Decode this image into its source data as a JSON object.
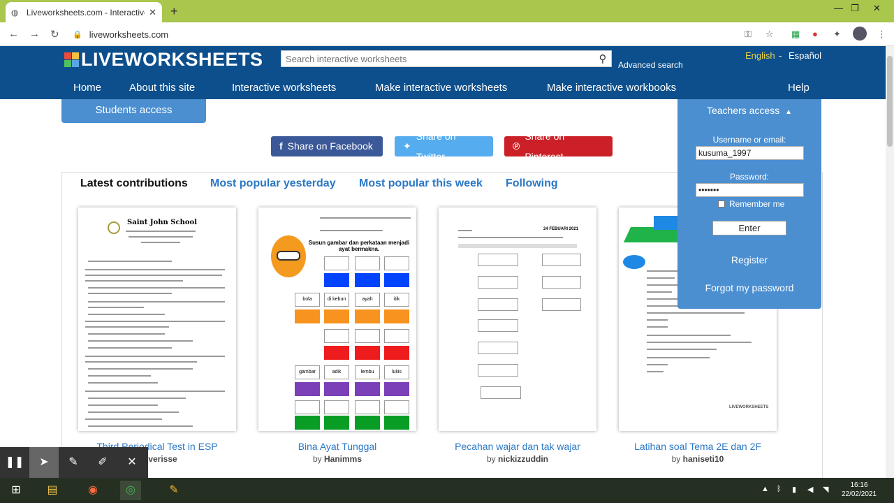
{
  "browser": {
    "tab_title": "Liveworksheets.com - Interactive",
    "url": "liveworksheets.com",
    "new_tab": "+",
    "close": "✕"
  },
  "header": {
    "logo": "LIVEWORKSHEETS",
    "search_placeholder": "Search interactive worksheets",
    "advanced_search": "Advanced search",
    "lang_en": "English",
    "lang_sep": "-",
    "lang_es": "Español",
    "menu": [
      "Home",
      "About this site",
      "Interactive worksheets",
      "Make interactive worksheets",
      "Make interactive workbooks",
      "Help"
    ]
  },
  "students_access": "Students access",
  "share": {
    "facebook": "Share on Facebook",
    "twitter": "Share on Twitter",
    "pinterest": "Share on Pinterest"
  },
  "tabs": [
    "Latest contributions",
    "Most popular yesterday",
    "Most popular this week",
    "Following"
  ],
  "cards": [
    {
      "title": "Third Periodical Test in ESP",
      "author_prefix": "by",
      "author": "verisse",
      "thumb_text": "Saint John School"
    },
    {
      "title": "Bina Ayat Tunggal",
      "author_prefix": "by",
      "author": "Hanimms",
      "thumb_text": "Susun gambar dan perkataan menjadi ayat bermakna."
    },
    {
      "title": "Pecahan wajar dan tak wajar",
      "author_prefix": "by",
      "author": "nickizzuddin",
      "thumb_text": "24 FEBUARI 2021"
    },
    {
      "title": "Latihan soal Tema 2E dan 2F",
      "author_prefix": "by",
      "author": "haniseti10",
      "thumb_text": "LIVEWORKSHEETS"
    }
  ],
  "thumb2_words": [
    "bola",
    "di kebun",
    "ayah",
    "itik",
    "gambar",
    "adik",
    "lembu",
    "lukis"
  ],
  "teachers": {
    "heading": "Teachers access",
    "username_label": "Username or email:",
    "username_value": "kusuma_1997",
    "password_label": "Password:",
    "password_value": "•••••••",
    "remember": "Remember me",
    "enter": "Enter",
    "register": "Register",
    "forgot": "Forgot my password"
  },
  "taskbar": {
    "time": "16:16",
    "date": "22/02/2021"
  },
  "colors": {
    "header_bg": "#0d4f8c",
    "panel_bg": "#4b8fd1",
    "link": "#2a78c5",
    "facebook": "#3b5998",
    "twitter": "#55acee",
    "pinterest": "#cb2027"
  }
}
